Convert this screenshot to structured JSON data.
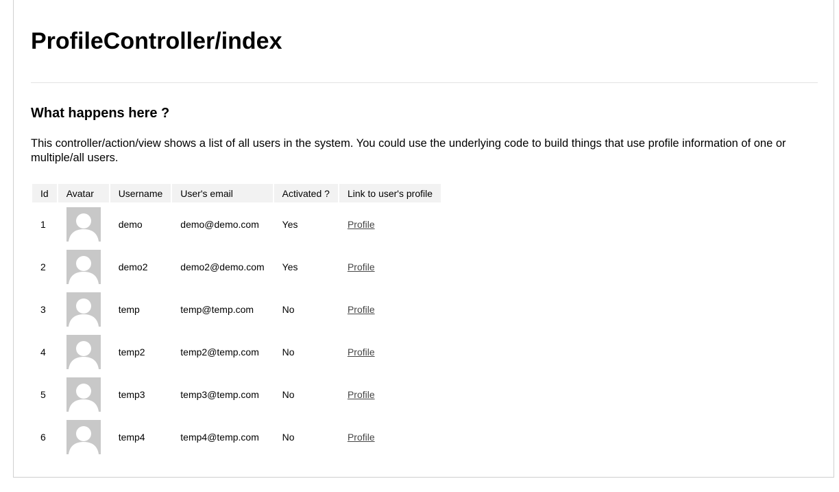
{
  "page": {
    "title": "ProfileController/index",
    "section_heading": "What happens here ?",
    "description": "This controller/action/view shows a list of all users in the system. You could use the underlying code to build things that use profile information of one or multiple/all users."
  },
  "table": {
    "headers": [
      "Id",
      "Avatar",
      "Username",
      "User's email",
      "Activated ?",
      "Link to user's profile"
    ],
    "rows": [
      {
        "id": "1",
        "username": "demo",
        "email": "demo@demo.com",
        "activated": "Yes",
        "link": "Profile"
      },
      {
        "id": "2",
        "username": "demo2",
        "email": "demo2@demo.com",
        "activated": "Yes",
        "link": "Profile"
      },
      {
        "id": "3",
        "username": "temp",
        "email": "temp@temp.com",
        "activated": "No",
        "link": "Profile"
      },
      {
        "id": "4",
        "username": "temp2",
        "email": "temp2@temp.com",
        "activated": "No",
        "link": "Profile"
      },
      {
        "id": "5",
        "username": "temp3",
        "email": "temp3@temp.com",
        "activated": "No",
        "link": "Profile"
      },
      {
        "id": "6",
        "username": "temp4",
        "email": "temp4@temp.com",
        "activated": "No",
        "link": "Profile"
      }
    ]
  },
  "icons": {
    "avatar": "default-avatar-icon"
  },
  "colors": {
    "avatar_bg": "#c8c8c8",
    "header_bg": "#f2f2f2",
    "link": "#444444"
  }
}
